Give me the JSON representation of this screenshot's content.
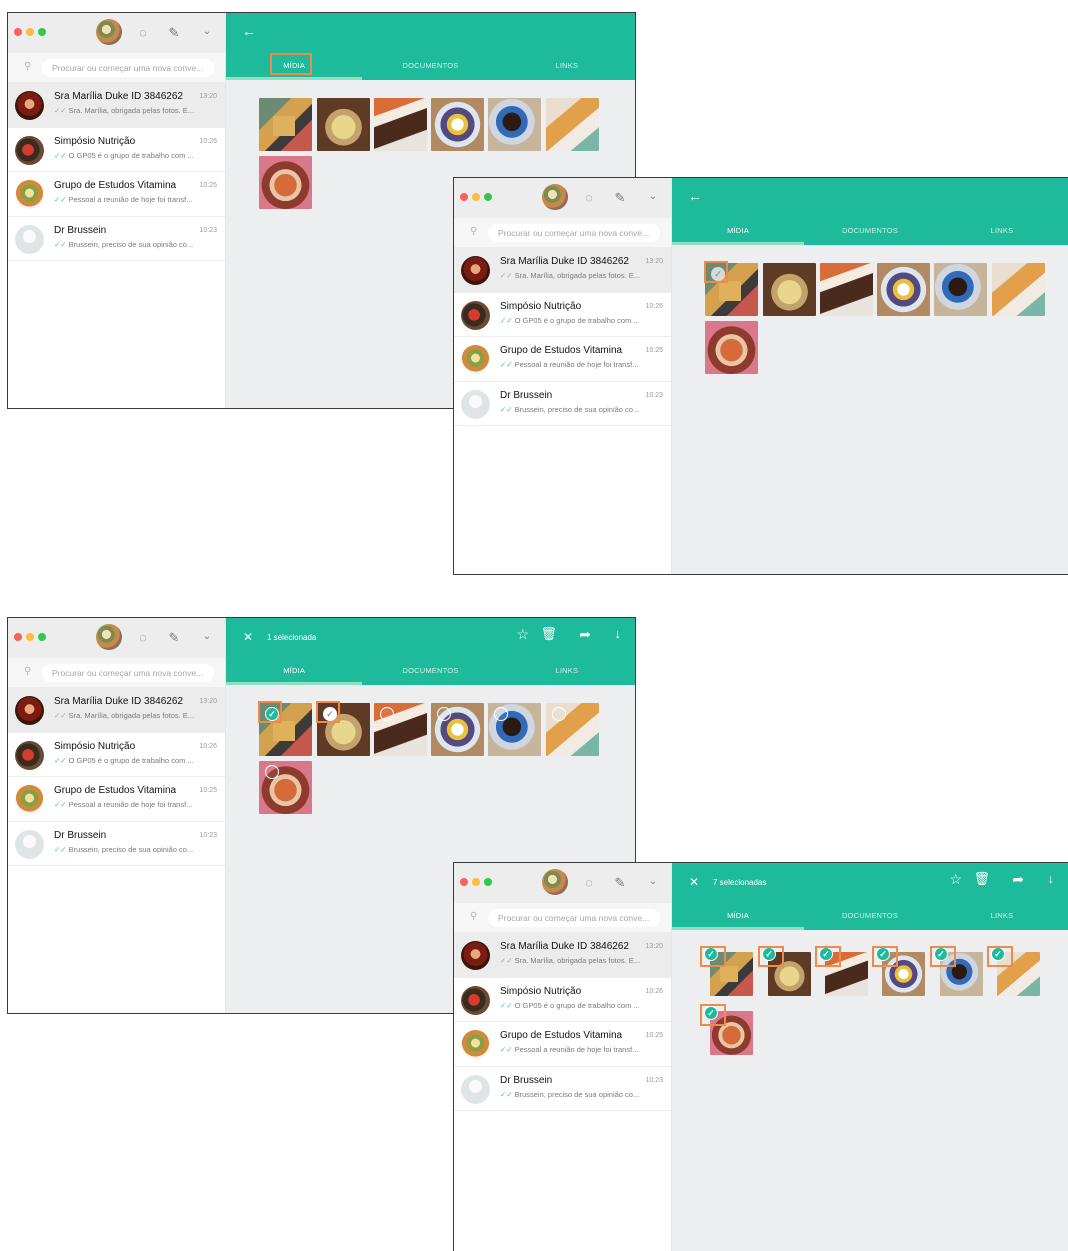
{
  "search_placeholder": "Procurar ou começar uma nova conve...",
  "chats": [
    {
      "name": "Sra Marília Duke ID 3846262",
      "time": "13:20",
      "preview": "Sra. Marília, obrigada pelas fotos. E...",
      "tick": "✓✓"
    },
    {
      "name": "Simpósio Nutrição",
      "time": "10:26",
      "preview": "O GP05 é o grupo de trabalho com ...",
      "tick": "✓✓"
    },
    {
      "name": "Grupo de Estudos Vitamina",
      "time": "10:25",
      "preview": "Pessoal a reunião de hoje foi transf...",
      "tick": "✓✓"
    },
    {
      "name": "Dr Brussein",
      "time": "10:23",
      "preview": "Brussein, preciso de sua opinião co...",
      "tick": "✓✓"
    }
  ],
  "tabs": [
    "MÍDIA",
    "DOCUMENTOS",
    "LINKS"
  ],
  "back_glyph": "←",
  "close_glyph": "✕",
  "selection": {
    "one": "1 selecionada",
    "all": "7 selecionadas"
  },
  "actions": {
    "star": "☆",
    "trash": "🗑",
    "forward": "➦",
    "download": "↓"
  },
  "icons": {
    "status": "◌",
    "new_chat": "✎",
    "dropdown": "⌄",
    "search": "⚲",
    "check": "✓"
  },
  "colors": {
    "header": "#1dbb9c",
    "highlight": "#f08a4b",
    "check_blue": "#34b7f1"
  }
}
